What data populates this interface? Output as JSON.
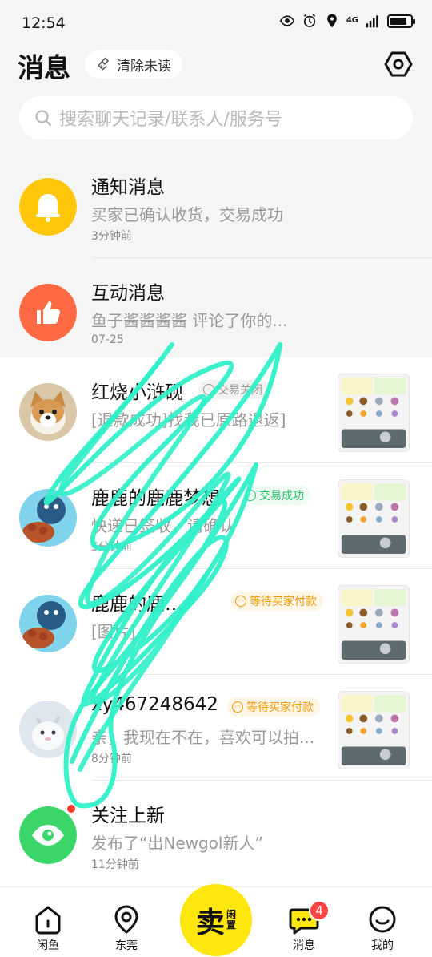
{
  "status_bar": {
    "time": "12:54",
    "network": "4G"
  },
  "header": {
    "title": "消息",
    "clear_unread_label": "清除未读"
  },
  "search": {
    "placeholder": "搜索聊天记录/联系人/服务号"
  },
  "pinned": [
    {
      "title": "通知消息",
      "subtitle": "买家已确认收货，交易成功",
      "time": "3分钟前",
      "icon": "bell-icon",
      "color": "#ffc60a"
    },
    {
      "title": "互动消息",
      "subtitle": "鱼子酱酱酱酱 评论了你的...",
      "time": "07-25",
      "icon": "thumbs-up-icon",
      "color": "#ff6a45"
    }
  ],
  "chats": [
    {
      "title": "红烧小浒砚",
      "tag": "交易关闭",
      "tag_type": "grey",
      "subtitle": "[退款成功]找我已原路退返]",
      "time": "",
      "avatar": "corgi-avatar"
    },
    {
      "title": "鹿鹿的鹿鹿梦想",
      "tag": "交易成功",
      "tag_type": "green",
      "subtitle": "快递已签收，请确认",
      "time": "5分钟前",
      "avatar": "blue-cartoon-avatar"
    },
    {
      "title": "鹿鹿的鹿…",
      "tag": "等待买家付款",
      "tag_type": "orange",
      "subtitle": "[图片]",
      "time": "",
      "avatar": "blue-cartoon-avatar"
    },
    {
      "title": "xy467248642",
      "tag": "等待买家付款",
      "tag_type": "orange",
      "subtitle": "亲，我现在不在，喜欢可以拍...",
      "time": "8分钟前",
      "avatar": "white-creature-avatar"
    },
    {
      "title": "关注上新",
      "subtitle": "发布了“出Newgol新人”",
      "time": "11分钟前",
      "avatar": "eye-avatar"
    }
  ],
  "bottom_nav": {
    "home": "闲鱼",
    "local": "东莞",
    "sell_main": "卖",
    "sell_sub_1": "闲",
    "sell_sub_2": "置",
    "messages": "消息",
    "messages_badge": "4",
    "me": "我的"
  },
  "colors": {
    "brand_yellow": "#ffe60f",
    "scribble": "#2ff0c8",
    "tag_orange": "#f39800",
    "tag_green": "#21c36b"
  }
}
